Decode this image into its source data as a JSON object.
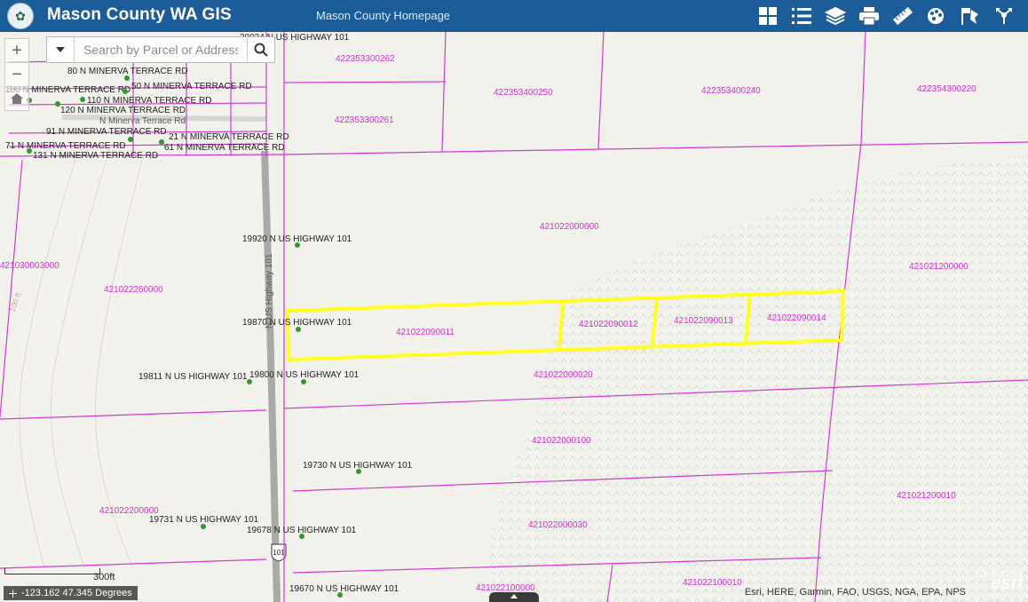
{
  "header": {
    "title": "Mason County WA GIS",
    "homepage_link": "Mason County Homepage",
    "logo_icon": "county-seal-icon",
    "tools": [
      {
        "icon": "basemap-gallery-icon"
      },
      {
        "icon": "layer-list-icon"
      },
      {
        "icon": "layers-icon"
      },
      {
        "icon": "print-icon"
      },
      {
        "icon": "measure-icon"
      },
      {
        "icon": "draw-icon"
      },
      {
        "icon": "bookmark-icon"
      },
      {
        "icon": "share-icon"
      }
    ]
  },
  "search": {
    "placeholder": "Search by Parcel or Address"
  },
  "map": {
    "colors": {
      "parcel_line": "#d23ad2",
      "parcel_label": "#d42cd4",
      "selection": "#ffff22",
      "road": "#a9a9a9",
      "point": "#2e9a2e",
      "hatch": "#d2e0d4"
    },
    "road_name": "N US Highway 101",
    "shield_label": "101",
    "small_road_label": "N Minerva Terrace Rd",
    "contour_label": "100 ft",
    "parcel_labels": [
      "422353300262",
      "422353400250",
      "422353400240",
      "422354300220",
      "422353300261",
      "421022000000",
      "421021200000",
      "421030003000",
      "421022260000",
      "421022090011",
      "421022090012",
      "421022090013",
      "421022090014",
      "421022000020",
      "421022000100",
      "421021200010",
      "421022200000",
      "421022000030",
      "421022100000",
      "421022100010"
    ],
    "address_labels": [
      "19920 N US HIGHWAY 101",
      "19870 N US HIGHWAY 101",
      "19811 N US HIGHWAY 101",
      "19800 N US HIGHWAY 101",
      "19730 N US HIGHWAY 101",
      "19731 N US HIGHWAY 101",
      "19678 N US HIGHWAY 101",
      "19670 N US HIGHWAY 101",
      "20024 N US HIGHWAY 101",
      "80 N MINERVA TERRACE RD",
      "100 N MINERVA TERRACE RD",
      "50 N MINERVA TERRACE RD",
      "110 N MINERVA TERRACE RD",
      "120 N MINERVA TERRACE RD",
      "91 N MINERVA TERRACE RD",
      "21 N MINERVA TERRACE RD",
      "71 N MINERVA TERRACE RD",
      "61 N MINERVA TERRACE RD",
      "131 N MINERVA TERRACE RD"
    ]
  },
  "scale": {
    "label": "300ft"
  },
  "coords": {
    "text": "-123.162 47.345 Degrees"
  },
  "attribution": "Esri, HERE, Garmin, FAO, USGS, NGA, EPA, NPS",
  "esri": {
    "powered": "POWERED BY",
    "name": "esri"
  }
}
